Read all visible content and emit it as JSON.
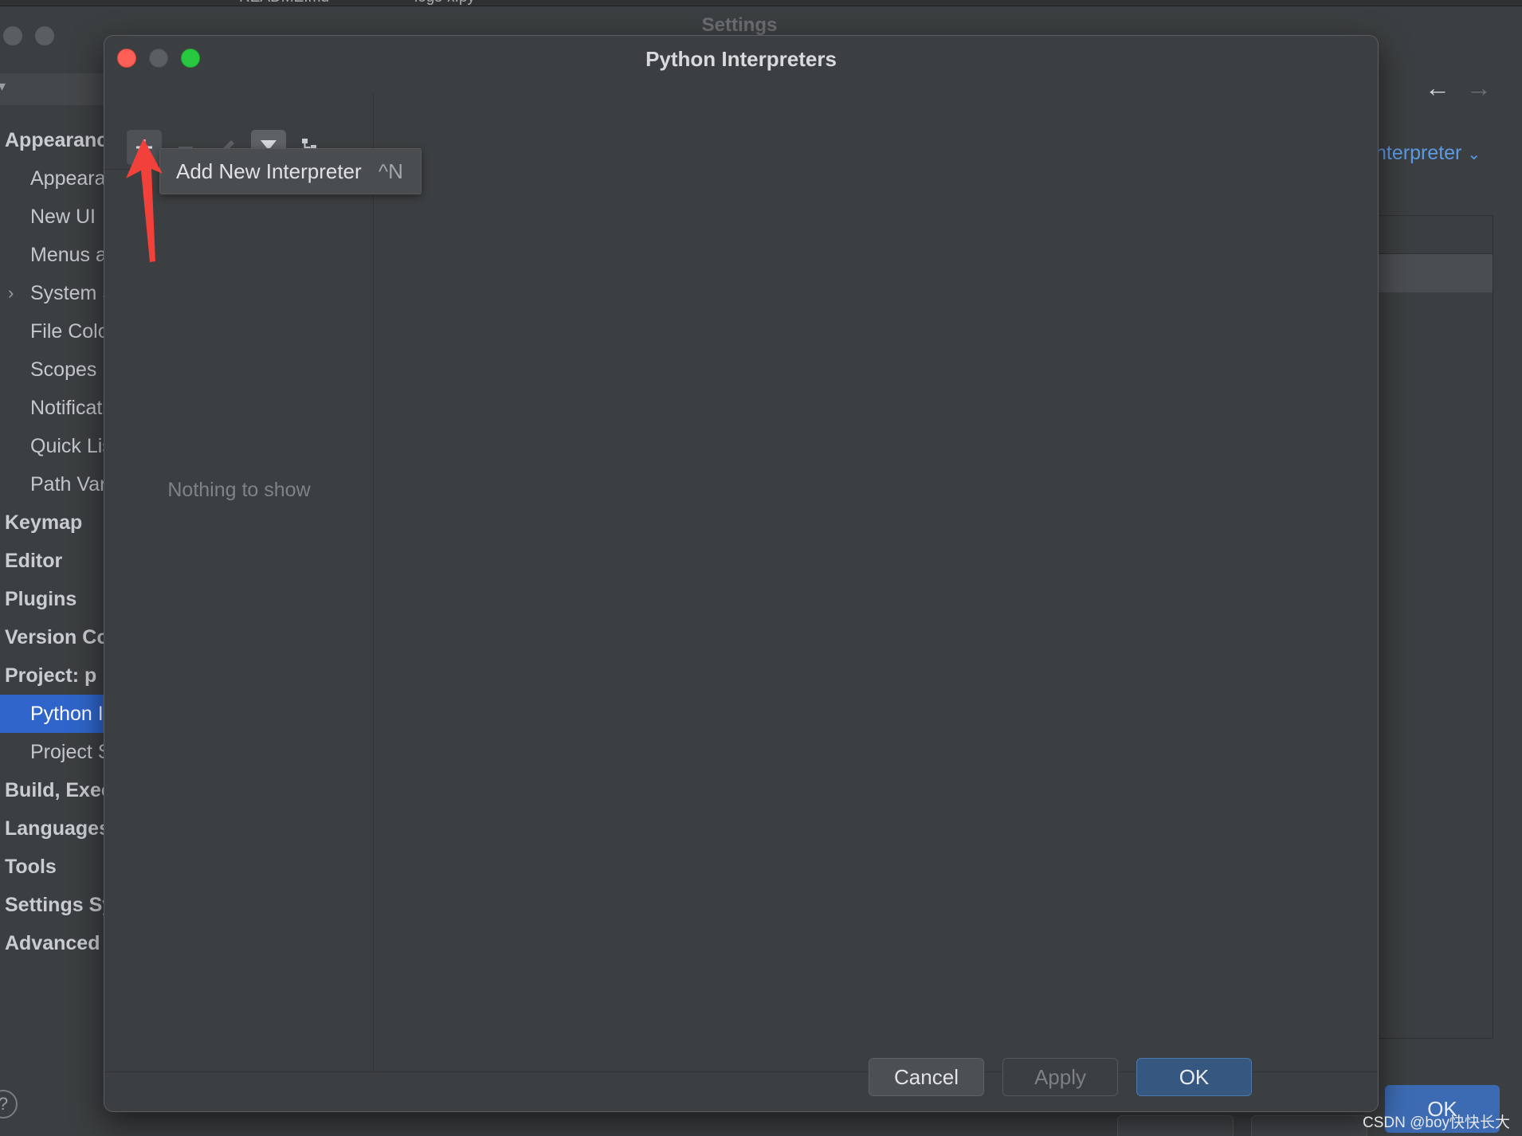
{
  "ide_tabs": [
    "README.md",
    "logs-x.py"
  ],
  "settings": {
    "title": "Settings",
    "tree": {
      "items": [
        {
          "label": "Appearance & Behavior",
          "level": 0
        },
        {
          "label": "Appearance",
          "level": 1
        },
        {
          "label": "New UI",
          "level": 1
        },
        {
          "label": "Menus and Toolbars",
          "level": 1
        },
        {
          "label": "System Settings",
          "level": 1,
          "expandable": true
        },
        {
          "label": "File Colors",
          "level": 1
        },
        {
          "label": "Scopes",
          "level": 1
        },
        {
          "label": "Notifications",
          "level": 1
        },
        {
          "label": "Quick Lists",
          "level": 1
        },
        {
          "label": "Path Variables",
          "level": 1
        },
        {
          "label": "Keymap",
          "level": 0
        },
        {
          "label": "Editor",
          "level": 0
        },
        {
          "label": "Plugins",
          "level": 0
        },
        {
          "label": "Version Control",
          "level": 0
        },
        {
          "label": "Project: p",
          "level": 0
        },
        {
          "label": "Python Interpreter",
          "level": 1,
          "selected": true
        },
        {
          "label": "Project Structure",
          "level": 1
        },
        {
          "label": "Build, Execution, Deployment",
          "level": 0
        },
        {
          "label": "Languages & Frameworks",
          "level": 0
        },
        {
          "label": "Tools",
          "level": 0
        },
        {
          "label": "Settings Sync",
          "level": 0
        },
        {
          "label": "Advanced Settings",
          "level": 0
        }
      ]
    },
    "interpreter_link": "nterpreter",
    "ok_label": "OK",
    "help_label": "?"
  },
  "dialog": {
    "title": "Python Interpreters",
    "toolbar": {
      "add_icon": "plus-icon",
      "remove_icon": "minus-icon",
      "edit_icon": "pencil-icon",
      "filter_icon": "filter-icon",
      "tree_icon": "tree-icon"
    },
    "tooltip": {
      "label": "Add New Interpreter",
      "shortcut": "^N"
    },
    "empty_text": "Nothing to show",
    "buttons": {
      "cancel": "Cancel",
      "apply": "Apply",
      "ok": "OK"
    }
  },
  "watermark": "CSDN @boy快快长大",
  "colors": {
    "accent": "#2f65ca",
    "ok_button": "#365880",
    "close": "#fe5f57",
    "maximize": "#28c840",
    "annotation": "#f2403a"
  }
}
